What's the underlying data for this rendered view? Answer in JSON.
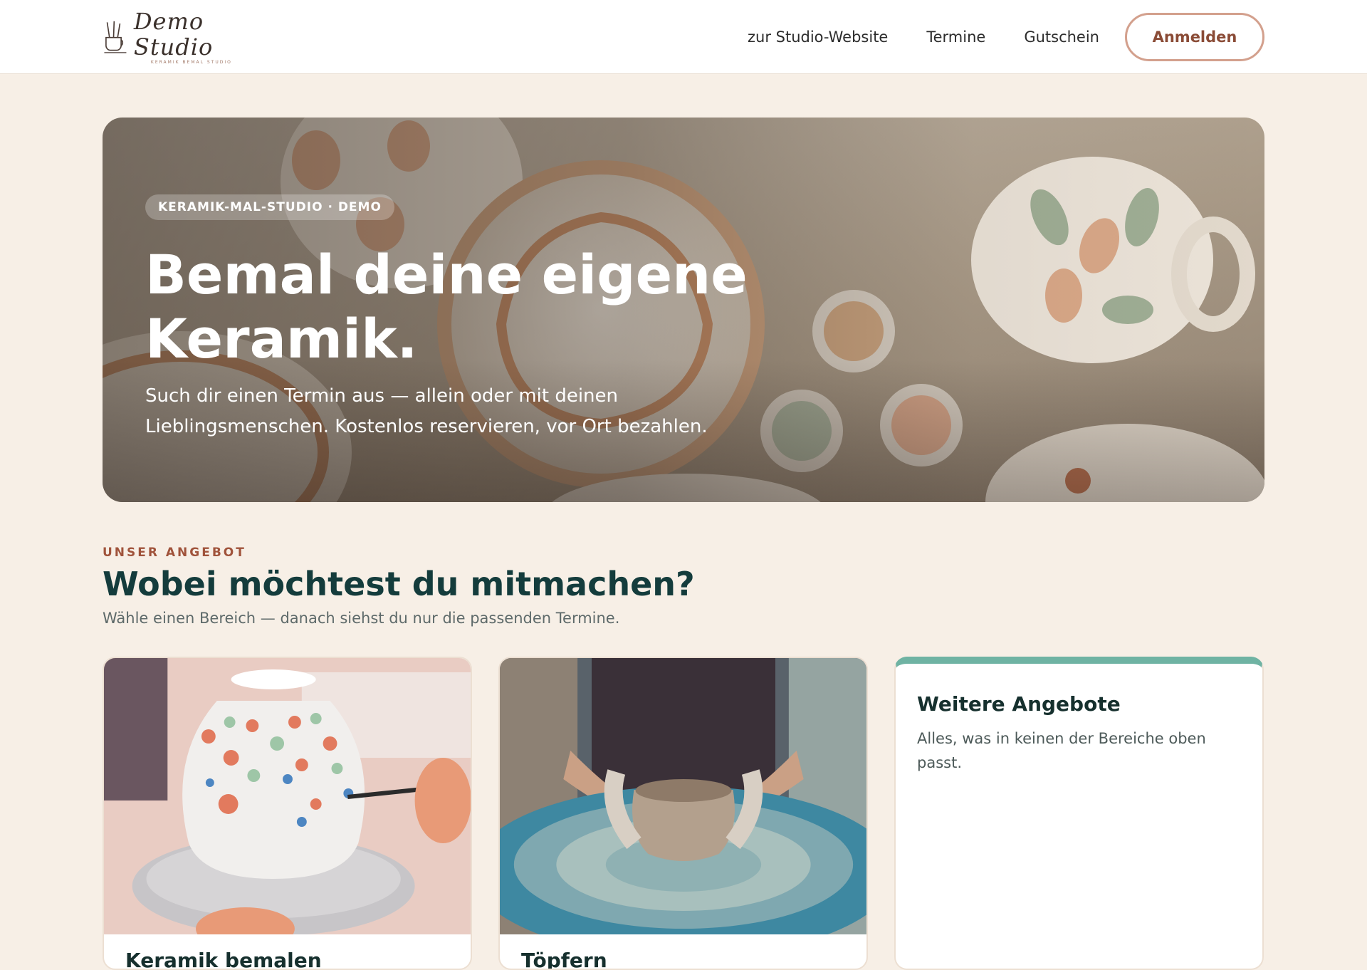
{
  "header": {
    "logo_name": "Demo Studio",
    "logo_sub": "KERAMIK BEMAL STUDIO",
    "nav": [
      "zur Studio-Website",
      "Termine",
      "Gutschein"
    ],
    "login_label": "Anmelden"
  },
  "hero": {
    "badge": "KERAMIK-MAL-STUDIO · DEMO",
    "title_line1": "Bemal deine eigene",
    "title_line2": "Keramik.",
    "subtitle": "Such dir einen Termin aus — allein oder mit deinen Lieblingsmenschen. Kostenlos reservieren, vor Ort bezahlen."
  },
  "section": {
    "kicker": "UNSER ANGEBOT",
    "title": "Wobei möchtest du mitmachen?",
    "subtitle": "Wähle einen Bereich — danach siehst du nur die passenden Termine."
  },
  "cards": [
    {
      "title": "Keramik bemalen",
      "image": "painted-vase-photo"
    },
    {
      "title": "Töpfern",
      "image": "pottery-wheel-photo"
    },
    {
      "title": "Weitere Angebote",
      "description": "Alles, was in keinen der Bereiche oben passt."
    }
  ],
  "colors": {
    "background": "#f7efe6",
    "accent": "#a0533b",
    "heading": "#143c3c",
    "card_accent": "#6fb3a3"
  }
}
